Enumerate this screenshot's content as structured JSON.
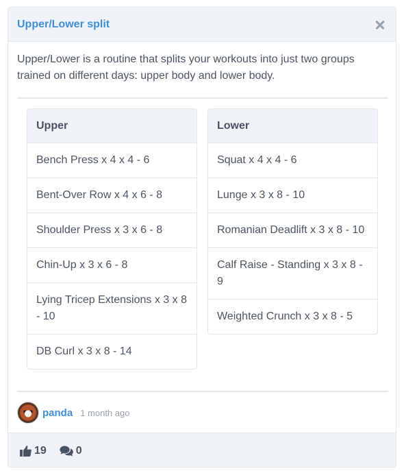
{
  "card": {
    "title": "Upper/Lower split",
    "description": "Upper/Lower is a routine that splits your workouts into just two groups trained on different days: upper body and lower body."
  },
  "columns": [
    {
      "heading": "Upper",
      "items": [
        "Bench Press x 4 x 4 - 6",
        "Bent-Over Row x 4 x 6 - 8",
        "Shoulder Press x 3 x 6 - 8",
        "Chin-Up x 3 x 6 - 8",
        "Lying Tricep Extensions x 3 x 8 - 10",
        "DB Curl x 3 x 8 - 14"
      ]
    },
    {
      "heading": "Lower",
      "items": [
        "Squat x 4 x 4 - 6",
        "Lunge x 3 x 8 - 10",
        "Romanian Deadlift x 3 x 8 - 10",
        "Calf Raise - Standing x 3 x 8 - 9",
        "Weighted Crunch x 3 x 8 - 5"
      ]
    }
  ],
  "author": {
    "name": "panda",
    "posted": "1 month ago"
  },
  "stats": {
    "likes": "19",
    "comments": "0"
  },
  "icons": {
    "close": "close-icon",
    "like": "thumbs-up-icon",
    "comments": "comments-icon"
  },
  "colors": {
    "accent": "#3f8fd6",
    "header_bg": "#eff2f7",
    "border": "#e4e7ec"
  }
}
